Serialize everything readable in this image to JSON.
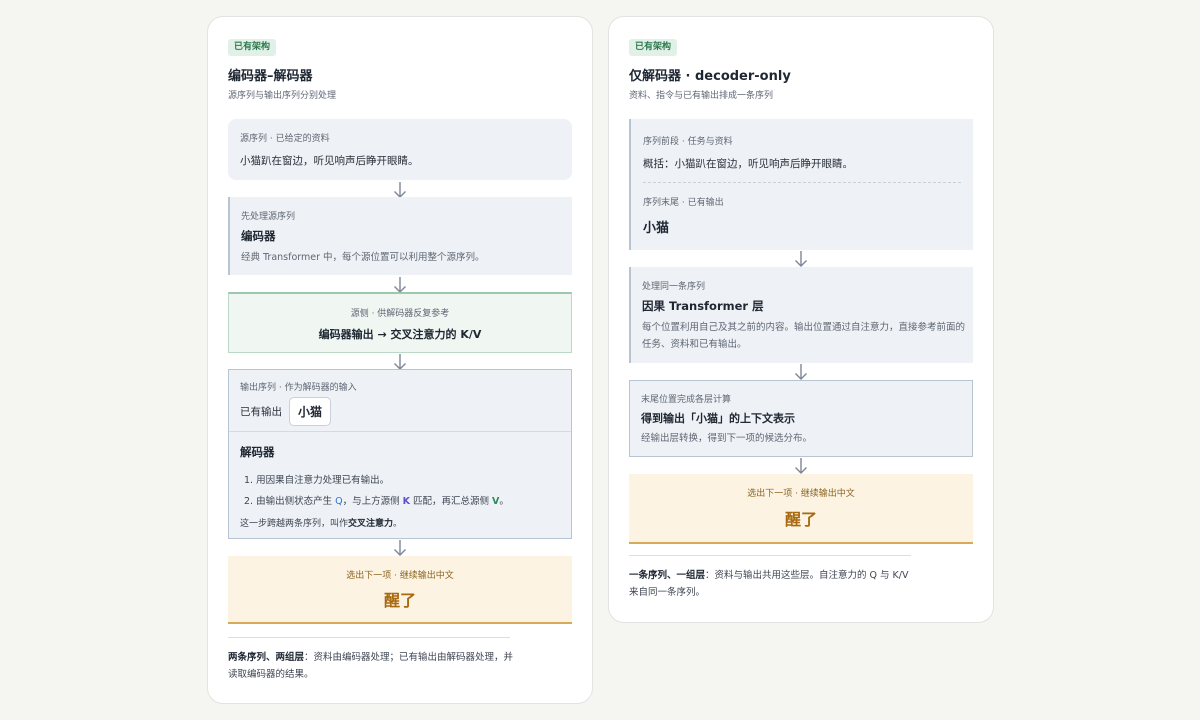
{
  "encoder_decoder": {
    "tag": "已有架构",
    "title": "编码器–解码器",
    "subtitle": "源序列与输出序列分别处理",
    "source": {
      "eyebrow": "源序列 · 已给定的资料",
      "text": "小猫趴在窗边，听见响声后睁开眼睛。"
    },
    "encoder": {
      "eyebrow": "先处理源序列",
      "title": "编码器",
      "desc": "经典 Transformer 中，每个源位置可以利用整个源序列。"
    },
    "memory": {
      "eyebrow": "源侧 · 供解码器反复参考",
      "title": "编码器输出 → 交叉注意力的 K/V"
    },
    "output_seq": {
      "eyebrow": "输出序列 · 作为解码器的输入",
      "label": "已有输出",
      "token": "小猫"
    },
    "decoder": {
      "title": "解码器",
      "step1": "1. 用因果自注意力处理已有输出。",
      "step2_a": "2. 由输出侧状态产生 ",
      "step2_q": "Q",
      "step2_b": "，与上方源侧 ",
      "step2_k": "K",
      "step2_c": " 匹配，再汇总源侧 ",
      "step2_v": "V",
      "step2_d": "。",
      "note_a": "这一步跨越两条序列，叫作",
      "note_b": "交叉注意力",
      "note_c": "。"
    },
    "result": {
      "eyebrow": "选出下一项 · 继续输出中文",
      "token": "醒了"
    },
    "footer": {
      "bold": "两条序列、两组层",
      "text": "：资料由编码器处理；已有输出由解码器处理，并读取编码器的结果。"
    }
  },
  "decoder_only": {
    "tag": "已有架构",
    "title": "仅解码器 · decoder-only",
    "subtitle": "资料、指令与已有输出排成一条序列",
    "sequence": {
      "eyebrow1": "序列前段 · 任务与资料",
      "text1": "概括：小猫趴在窗边，听见响声后睁开眼睛。",
      "eyebrow2": "序列末尾 · 已有输出",
      "token": "小猫"
    },
    "causal": {
      "eyebrow": "处理同一条序列",
      "title": "因果 Transformer 层",
      "desc": "每个位置利用自己及其之前的内容。输出位置通过自注意力，直接参考前面的任务、资料和已有输出。"
    },
    "final": {
      "eyebrow": "末尾位置完成各层计算",
      "title": "得到输出「小猫」的上下文表示",
      "desc": "经输出层转换，得到下一项的候选分布。"
    },
    "result": {
      "eyebrow": "选出下一项 · 继续输出中文",
      "token": "醒了"
    },
    "footer": {
      "bold": "一条序列、一组层",
      "text": "：资料与输出共用这些层。自注意力的 Q 与 K/V 来自同一条序列。"
    }
  }
}
